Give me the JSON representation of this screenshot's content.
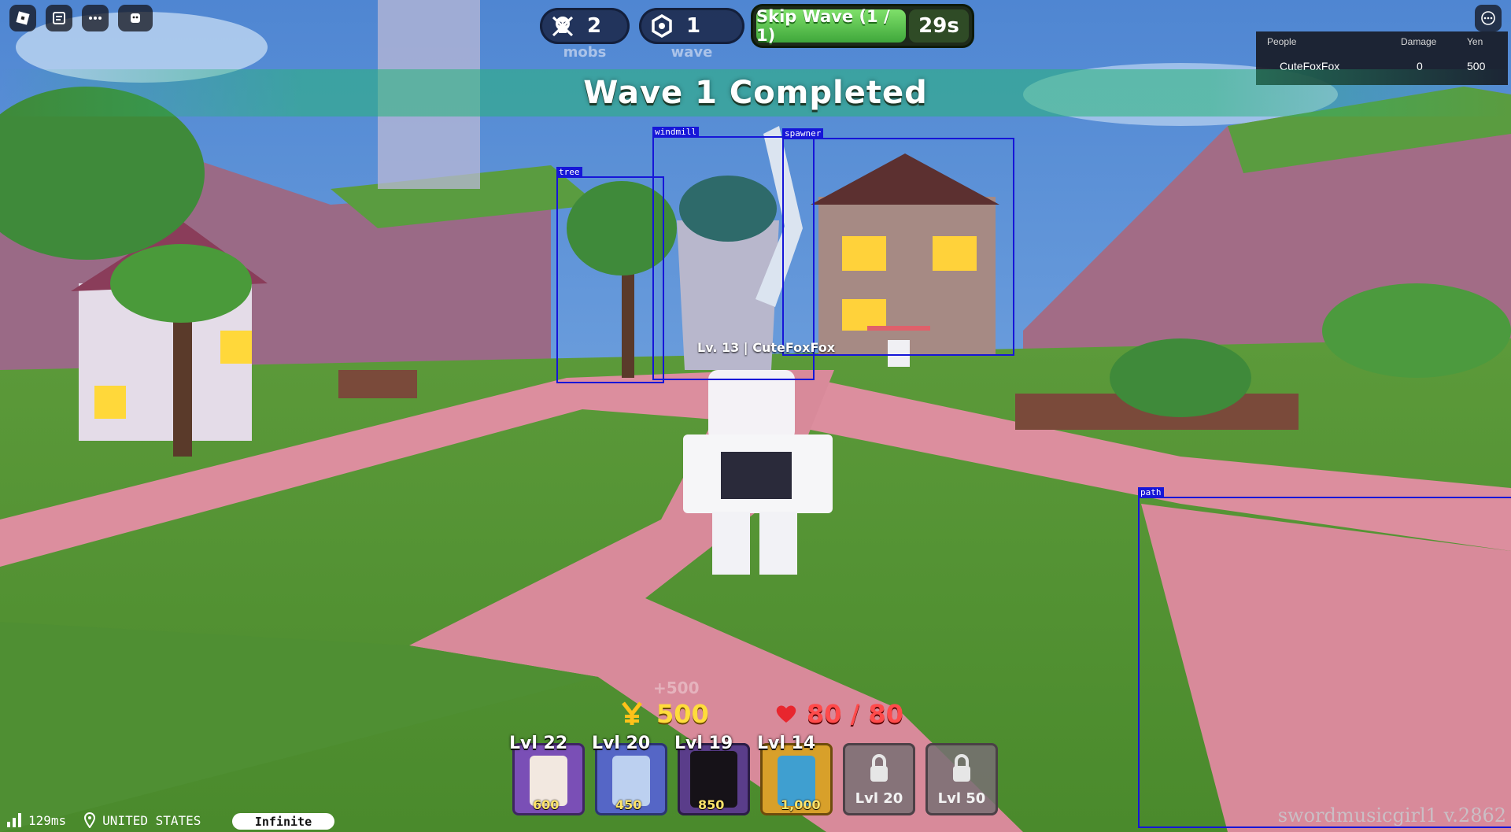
{
  "hud": {
    "mobs_count": "2",
    "mobs_label": "mobs",
    "wave_count": "1",
    "wave_label": "wave",
    "skip_label": "Skip Wave (1 / 1)",
    "skip_timer": "29s",
    "banner": "Wave 1 Completed",
    "float_gain": "+500",
    "yen": "500",
    "health": "80 / 80"
  },
  "leaderboard": {
    "headers": [
      "People",
      "Damage",
      "Yen"
    ],
    "rows": [
      {
        "name": "CuteFoxFox",
        "damage": "0",
        "yen": "500"
      }
    ]
  },
  "player": {
    "tag": "Lv. 13 | CuteFoxFox"
  },
  "detections": [
    {
      "label": "tree"
    },
    {
      "label": "windmill"
    },
    {
      "label": "spawner"
    },
    {
      "label": "path"
    }
  ],
  "units": [
    {
      "level": "Lvl 22",
      "cost": "600",
      "color": "#7a4fb6"
    },
    {
      "level": "Lvl 20",
      "cost": "450",
      "color": "#5566c6"
    },
    {
      "level": "Lvl 19",
      "cost": "850",
      "color": "#5a3d8a"
    },
    {
      "level": "Lvl 14",
      "cost": "1,000",
      "color": "#d8a02a"
    }
  ],
  "locked_slots": [
    {
      "level": "Lvl 20"
    },
    {
      "level": "Lvl 50"
    }
  ],
  "status": {
    "ping": "129ms",
    "region": "UNITED STATES",
    "mode": "Infinite",
    "version": "swordmusicgirl1 v.2862"
  }
}
